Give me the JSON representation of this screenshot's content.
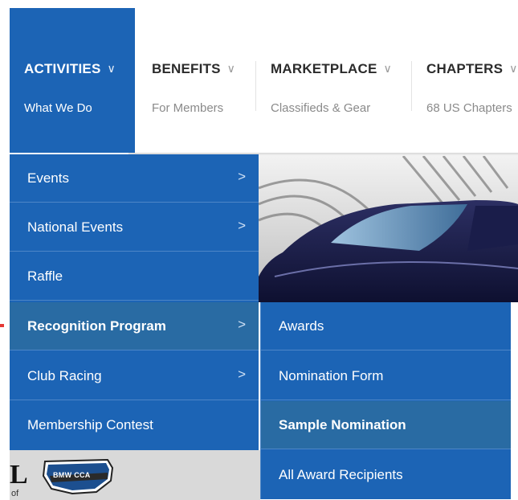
{
  "nav": {
    "items": [
      {
        "label": "ACTIVITIES",
        "sub": "What We Do",
        "active": true
      },
      {
        "label": "BENEFITS",
        "sub": "For Members"
      },
      {
        "label": "MARKETPLACE",
        "sub": "Classifieds & Gear"
      },
      {
        "label": "CHAPTERS",
        "sub": "68 US Chapters"
      }
    ],
    "chevron": "∨"
  },
  "menu": {
    "items": [
      {
        "label": "Events",
        "has_submenu": true
      },
      {
        "label": "National Events",
        "has_submenu": true
      },
      {
        "label": "Raffle",
        "has_submenu": false
      },
      {
        "label": "Recognition Program",
        "has_submenu": true,
        "active": true
      },
      {
        "label": "Club Racing",
        "has_submenu": true
      },
      {
        "label": "Membership Contest",
        "has_submenu": false
      }
    ],
    "arrow": ">"
  },
  "submenu": {
    "items": [
      {
        "label": "Awards"
      },
      {
        "label": "Nomination Form"
      },
      {
        "label": "Sample Nomination",
        "selected": true
      },
      {
        "label": "All Award Recipients"
      }
    ]
  },
  "logo": {
    "letter": "L",
    "sub": "of",
    "badge_text": "BMW CCA"
  },
  "colors": {
    "menu_blue": "#1c64b5",
    "active_item": "#296ba3",
    "divider": "#4d86c7"
  },
  "icons": {
    "nav_chevron": "chevron-down-icon",
    "menu_arrow": "chevron-right-icon"
  }
}
